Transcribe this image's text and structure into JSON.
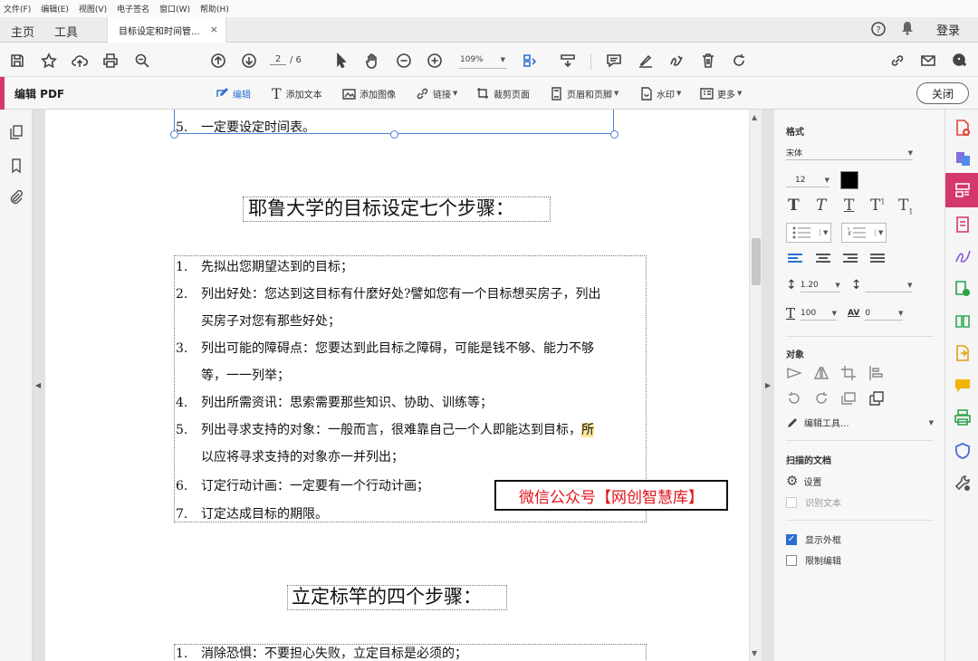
{
  "menu": [
    "文件(F)",
    "编辑(E)",
    "视图(V)",
    "电子签名",
    "窗口(W)",
    "帮助(H)"
  ],
  "tabs": {
    "home": "主页",
    "tools": "工具",
    "document": "目标设定和时间管...",
    "close": "×",
    "login": "登录"
  },
  "toolbar": {
    "page_current": "2",
    "page_total": "/ 6",
    "zoom": "109%"
  },
  "editbar": {
    "title": "编辑 PDF",
    "tools": [
      "编辑",
      "添加文本",
      "添加图像",
      "链接",
      "裁剪页面",
      "页眉和页脚",
      "水印",
      "更多"
    ],
    "close": "关闭"
  },
  "document": {
    "top_item": {
      "num": "5.",
      "text": "一定要设定时间表。"
    },
    "heading1": "耶鲁大学的目标设定七个步骤：",
    "list1": [
      {
        "num": "1.",
        "text": "先拟出您期望达到的目标；"
      },
      {
        "num": "2.",
        "text": "列出好处：您达到这目标有什麼好处?譬如您有一个目标想买房子，列出"
      },
      {
        "cont": "买房子对您有那些好处；"
      },
      {
        "num": "3.",
        "text": "列出可能的障碍点：您要达到此目标之障碍，可能是钱不够、能力不够"
      },
      {
        "cont": "等，一一列举；"
      },
      {
        "num": "4.",
        "text": "列出所需资讯：思索需要那些知识、协助、训练等；"
      },
      {
        "num": "5.",
        "text": "列出寻求支持的对象：一般而言，很难靠自己一个人即能达到目标，",
        "highlight": "所"
      },
      {
        "cont": "以应将寻求支持的对象亦一并列出；"
      },
      {
        "num": "6.",
        "text": "订定行动计画：一定要有一个行动计画；"
      },
      {
        "num": "7.",
        "text": "订定达成目标的期限。"
      }
    ],
    "watermark": "微信公众号【网创智慧库】",
    "heading2": "立定标竿的四个步骤：",
    "list2": [
      {
        "num": "1.",
        "text": "消除恐惧：不要担心失败，立定目标是必须的；"
      }
    ]
  },
  "panel": {
    "format_title": "格式",
    "font": "宋体",
    "font_size": "12",
    "color": "#000000",
    "line_spacing": "1.20",
    "para_spacing": "",
    "scale": "100",
    "char_spacing": "0",
    "object_title": "对象",
    "edit_tool": "编辑工具...",
    "scanned_title": "扫描的文档",
    "settings": "设置",
    "recognize": "识别文本",
    "show_bbox": "显示外框",
    "restrict": "限制编辑"
  },
  "colors": {
    "accent": "#d4376d",
    "selection": "#4a7fd6",
    "watermark_text": "#e0131a",
    "highlight": "#fbe89a"
  }
}
